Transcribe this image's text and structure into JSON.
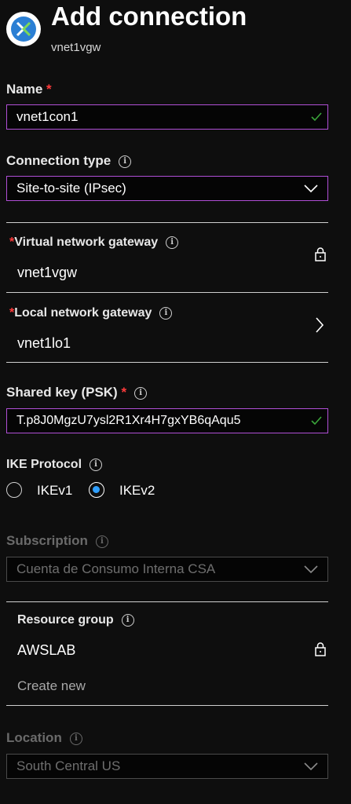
{
  "header": {
    "title": "Add connection",
    "subtitle": "vnet1vgw",
    "logo_icon": "connection-icon"
  },
  "name": {
    "label": "Name",
    "required": "*",
    "value": "vnet1con1"
  },
  "connection_type": {
    "label": "Connection type",
    "value": "Site-to-site (IPsec)"
  },
  "virtual_network_gateway": {
    "required": "*",
    "label": "Virtual network gateway",
    "value": "vnet1vgw"
  },
  "local_network_gateway": {
    "required": "*",
    "label": "Local network gateway",
    "value": "vnet1lo1"
  },
  "shared_key": {
    "label": "Shared key (PSK)",
    "required": "*",
    "value": "T.p8J0MgzU7ysl2R1Xr4H7gxYB6qAqu5"
  },
  "ike_protocol": {
    "label": "IKE Protocol",
    "options": [
      "IKEv1",
      "IKEv2"
    ],
    "selected": "IKEv2"
  },
  "subscription": {
    "label": "Subscription",
    "value": "Cuenta de Consumo Interna CSA"
  },
  "resource_group": {
    "label": "Resource group",
    "value": "AWSLAB",
    "create_new": "Create new"
  },
  "location": {
    "label": "Location",
    "value": "South Central US"
  },
  "colors": {
    "background": "#0e0e0e",
    "focus_border": "#b04fd6",
    "required": "#ff3b3b",
    "valid_check": "#3aa53a",
    "radio_selected": "#2f9fff"
  }
}
